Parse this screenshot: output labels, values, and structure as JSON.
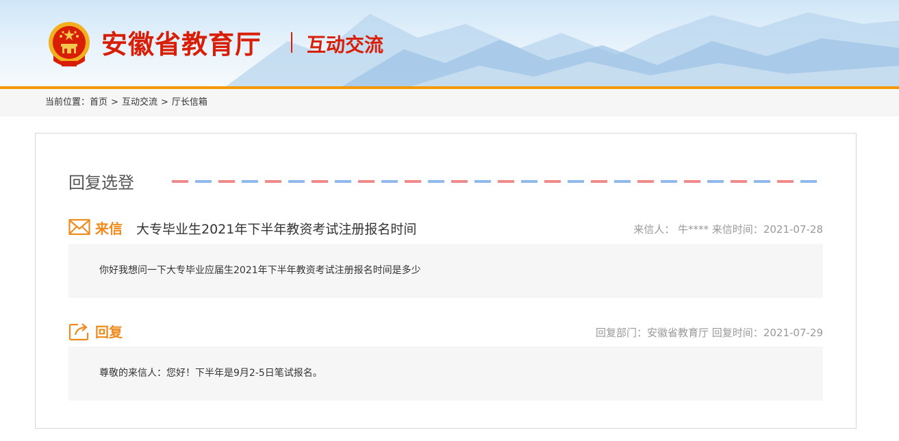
{
  "header": {
    "site_title": "安徽省教育厅",
    "section_title": "互动交流"
  },
  "breadcrumb": {
    "prefix": "当前位置：",
    "items": [
      "首页",
      "互动交流",
      "厅长信箱"
    ],
    "separator": ">"
  },
  "panel": {
    "heading": "回复选登",
    "letter": {
      "label": "来信",
      "subject": "大专毕业生2021年下半年教资考试注册报名时间",
      "sender_label": "来信人：",
      "sender": "牛****",
      "date_label": "来信时间：",
      "date": "2021-07-28",
      "content": "你好我想问一下大专毕业应届生2021年下半年教资考试注册报名时间是多少"
    },
    "reply": {
      "label": "回复",
      "dept_label": "回复部门：",
      "dept": "安徽省教育厅",
      "date_label": "回复时间：",
      "date": "2021-07-29",
      "content": "尊敬的来信人：您好！下半年是9月2-5日笔试报名。"
    }
  },
  "colors": {
    "brand_red": "#d81e06",
    "accent_orange": "#f39800",
    "label_orange": "#f08a1c",
    "dash_red": "#f08a8a",
    "dash_blue": "#8fb8ec"
  },
  "icons": [
    "national-emblem-icon",
    "envelope-icon",
    "reply-share-icon"
  ]
}
